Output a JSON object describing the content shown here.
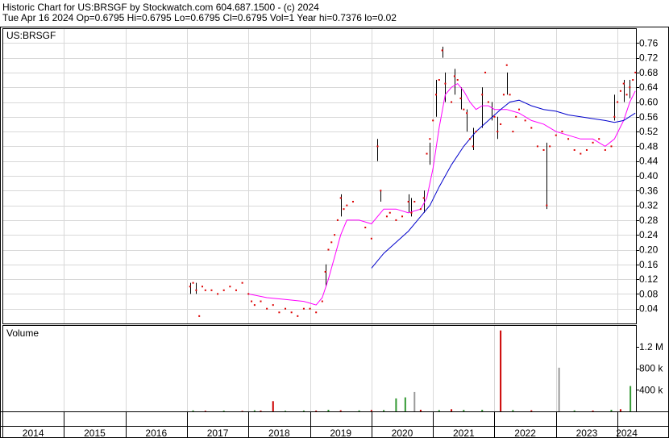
{
  "header": {
    "line1": "Historic Chart for US:BRSGF by Stockwatch.com 604.687.1500 - (c) 2024",
    "line2": "Tue Apr 16 2024   Op=0.6795   Hi=0.6795   Lo=0.6795   Cl=0.6795   Vol=1   Year hi=0.7376   lo=0.02"
  },
  "chart_data": [
    {
      "type": "line",
      "title": "US:BRSGF",
      "ylim": [
        0,
        0.8
      ],
      "y_ticks": [
        "0.04",
        "0.08",
        "0.12",
        "0.16",
        "0.20",
        "0.24",
        "0.28",
        "0.32",
        "0.36",
        "0.40",
        "0.44",
        "0.48",
        "0.52",
        "0.56",
        "0.60",
        "0.64",
        "0.68",
        "0.72",
        "0.76"
      ],
      "grid": true,
      "x_labels": [
        "2014",
        "2015",
        "2016",
        "2017",
        "2018",
        "2019",
        "2020",
        "2021",
        "2022",
        "2023",
        "2024"
      ],
      "x_range": [
        2014.0,
        2024.3
      ],
      "price_color": "#dd0000",
      "bar_color": "#000000",
      "series": [
        {
          "kind": "price",
          "points": [
            [
              2017.05,
              0.1
            ],
            [
              2017.1,
              0.11
            ],
            [
              2017.15,
              0.09
            ],
            [
              2017.2,
              0.02
            ],
            [
              2017.25,
              0.1
            ],
            [
              2017.3,
              0.09
            ],
            [
              2017.4,
              0.09
            ],
            [
              2017.5,
              0.08
            ],
            [
              2017.6,
              0.09
            ],
            [
              2017.7,
              0.1
            ],
            [
              2017.8,
              0.09
            ],
            [
              2017.9,
              0.11
            ],
            [
              2018.0,
              0.08
            ],
            [
              2018.05,
              0.06
            ],
            [
              2018.1,
              0.05
            ],
            [
              2018.2,
              0.06
            ],
            [
              2018.3,
              0.04
            ],
            [
              2018.4,
              0.05
            ],
            [
              2018.5,
              0.03
            ],
            [
              2018.6,
              0.04
            ],
            [
              2018.7,
              0.03
            ],
            [
              2018.8,
              0.02
            ],
            [
              2018.9,
              0.04
            ],
            [
              2019.0,
              0.04
            ],
            [
              2019.1,
              0.03
            ],
            [
              2019.2,
              0.06
            ],
            [
              2019.25,
              0.14
            ],
            [
              2019.3,
              0.2
            ],
            [
              2019.35,
              0.22
            ],
            [
              2019.4,
              0.24
            ],
            [
              2019.45,
              0.28
            ],
            [
              2019.5,
              0.34
            ],
            [
              2019.55,
              0.31
            ],
            [
              2019.6,
              0.32
            ],
            [
              2019.7,
              0.33
            ],
            [
              2019.9,
              0.26
            ],
            [
              2020.0,
              0.23
            ],
            [
              2020.1,
              0.48
            ],
            [
              2020.15,
              0.36
            ],
            [
              2020.25,
              0.29
            ],
            [
              2020.3,
              0.3
            ],
            [
              2020.4,
              0.28
            ],
            [
              2020.5,
              0.29
            ],
            [
              2020.6,
              0.33
            ],
            [
              2020.65,
              0.3
            ],
            [
              2020.7,
              0.33
            ],
            [
              2020.8,
              0.31
            ],
            [
              2020.85,
              0.34
            ],
            [
              2020.9,
              0.46
            ],
            [
              2020.95,
              0.5
            ],
            [
              2021.0,
              0.55
            ],
            [
              2021.05,
              0.62
            ],
            [
              2021.1,
              0.66
            ],
            [
              2021.15,
              0.74
            ],
            [
              2021.2,
              0.65
            ],
            [
              2021.3,
              0.6
            ],
            [
              2021.35,
              0.67
            ],
            [
              2021.4,
              0.66
            ],
            [
              2021.45,
              0.61
            ],
            [
              2021.5,
              0.58
            ],
            [
              2021.55,
              0.57
            ],
            [
              2021.6,
              0.5
            ],
            [
              2021.65,
              0.48
            ],
            [
              2021.7,
              0.52
            ],
            [
              2021.8,
              0.62
            ],
            [
              2021.85,
              0.68
            ],
            [
              2021.9,
              0.6
            ],
            [
              2022.0,
              0.56
            ],
            [
              2022.05,
              0.52
            ],
            [
              2022.1,
              0.54
            ],
            [
              2022.15,
              0.62
            ],
            [
              2022.2,
              0.7
            ],
            [
              2022.25,
              0.62
            ],
            [
              2022.3,
              0.52
            ],
            [
              2022.35,
              0.56
            ],
            [
              2022.4,
              0.58
            ],
            [
              2022.5,
              0.55
            ],
            [
              2022.6,
              0.53
            ],
            [
              2022.7,
              0.48
            ],
            [
              2022.8,
              0.47
            ],
            [
              2022.85,
              0.32
            ],
            [
              2022.9,
              0.48
            ],
            [
              2023.0,
              0.51
            ],
            [
              2023.1,
              0.52
            ],
            [
              2023.2,
              0.5
            ],
            [
              2023.3,
              0.47
            ],
            [
              2023.4,
              0.46
            ],
            [
              2023.5,
              0.47
            ],
            [
              2023.6,
              0.49
            ],
            [
              2023.7,
              0.5
            ],
            [
              2023.8,
              0.47
            ],
            [
              2023.9,
              0.48
            ],
            [
              2023.95,
              0.56
            ],
            [
              2024.0,
              0.6
            ],
            [
              2024.05,
              0.63
            ],
            [
              2024.1,
              0.65
            ],
            [
              2024.15,
              0.62
            ],
            [
              2024.2,
              0.64
            ],
            [
              2024.25,
              0.66
            ],
            [
              2024.29,
              0.68
            ]
          ]
        },
        {
          "kind": "hl_bar",
          "bars": [
            [
              2017.05,
              0.08,
              0.11
            ],
            [
              2017.15,
              0.08,
              0.11
            ],
            [
              2019.25,
              0.1,
              0.16
            ],
            [
              2019.5,
              0.29,
              0.35
            ],
            [
              2020.1,
              0.44,
              0.5
            ],
            [
              2020.15,
              0.33,
              0.36
            ],
            [
              2020.6,
              0.3,
              0.35
            ],
            [
              2020.65,
              0.29,
              0.34
            ],
            [
              2020.85,
              0.3,
              0.36
            ],
            [
              2020.95,
              0.43,
              0.49
            ],
            [
              2021.05,
              0.56,
              0.66
            ],
            [
              2021.15,
              0.72,
              0.75
            ],
            [
              2021.2,
              0.6,
              0.68
            ],
            [
              2021.35,
              0.62,
              0.69
            ],
            [
              2021.45,
              0.58,
              0.64
            ],
            [
              2021.55,
              0.52,
              0.58
            ],
            [
              2021.65,
              0.47,
              0.53
            ],
            [
              2021.8,
              0.53,
              0.64
            ],
            [
              2021.95,
              0.55,
              0.6
            ],
            [
              2022.05,
              0.5,
              0.56
            ],
            [
              2022.2,
              0.62,
              0.68
            ],
            [
              2022.85,
              0.31,
              0.49
            ],
            [
              2023.95,
              0.55,
              0.62
            ],
            [
              2024.1,
              0.6,
              0.66
            ],
            [
              2024.2,
              0.61,
              0.66
            ]
          ]
        },
        {
          "kind": "ma_short",
          "color": "#ff00ff",
          "points": [
            [
              2018.0,
              0.08
            ],
            [
              2018.3,
              0.07
            ],
            [
              2018.6,
              0.065
            ],
            [
              2018.9,
              0.06
            ],
            [
              2019.1,
              0.05
            ],
            [
              2019.2,
              0.07
            ],
            [
              2019.3,
              0.12
            ],
            [
              2019.4,
              0.18
            ],
            [
              2019.5,
              0.24
            ],
            [
              2019.6,
              0.28
            ],
            [
              2019.8,
              0.28
            ],
            [
              2020.0,
              0.27
            ],
            [
              2020.1,
              0.29
            ],
            [
              2020.2,
              0.31
            ],
            [
              2020.4,
              0.31
            ],
            [
              2020.6,
              0.3
            ],
            [
              2020.8,
              0.31
            ],
            [
              2020.9,
              0.34
            ],
            [
              2021.0,
              0.42
            ],
            [
              2021.1,
              0.53
            ],
            [
              2021.2,
              0.62
            ],
            [
              2021.3,
              0.64
            ],
            [
              2021.4,
              0.65
            ],
            [
              2021.5,
              0.63
            ],
            [
              2021.6,
              0.6
            ],
            [
              2021.7,
              0.58
            ],
            [
              2021.8,
              0.59
            ],
            [
              2021.9,
              0.59
            ],
            [
              2022.0,
              0.58
            ],
            [
              2022.2,
              0.58
            ],
            [
              2022.4,
              0.57
            ],
            [
              2022.6,
              0.55
            ],
            [
              2022.8,
              0.54
            ],
            [
              2023.0,
              0.52
            ],
            [
              2023.2,
              0.51
            ],
            [
              2023.4,
              0.5
            ],
            [
              2023.6,
              0.5
            ],
            [
              2023.8,
              0.48
            ],
            [
              2023.95,
              0.5
            ],
            [
              2024.1,
              0.55
            ],
            [
              2024.2,
              0.6
            ],
            [
              2024.29,
              0.63
            ]
          ]
        },
        {
          "kind": "ma_long",
          "color": "#0000cc",
          "points": [
            [
              2020.0,
              0.15
            ],
            [
              2020.2,
              0.19
            ],
            [
              2020.4,
              0.22
            ],
            [
              2020.6,
              0.25
            ],
            [
              2020.8,
              0.29
            ],
            [
              2020.95,
              0.32
            ],
            [
              2021.1,
              0.37
            ],
            [
              2021.3,
              0.43
            ],
            [
              2021.5,
              0.48
            ],
            [
              2021.7,
              0.52
            ],
            [
              2021.9,
              0.55
            ],
            [
              2022.1,
              0.58
            ],
            [
              2022.25,
              0.6
            ],
            [
              2022.4,
              0.605
            ],
            [
              2022.6,
              0.59
            ],
            [
              2022.8,
              0.58
            ],
            [
              2023.0,
              0.575
            ],
            [
              2023.2,
              0.565
            ],
            [
              2023.4,
              0.56
            ],
            [
              2023.6,
              0.555
            ],
            [
              2023.8,
              0.55
            ],
            [
              2023.95,
              0.545
            ],
            [
              2024.1,
              0.55
            ],
            [
              2024.29,
              0.57
            ]
          ]
        }
      ]
    },
    {
      "type": "bar",
      "title": "Volume",
      "ylim": [
        0,
        1600000
      ],
      "y_ticks": [
        "400 k",
        "800 k",
        "1.2 M"
      ],
      "y_tick_values": [
        400000,
        800000,
        1200000
      ],
      "bars": [
        [
          2017.1,
          18000,
          "#339933"
        ],
        [
          2017.3,
          12000,
          "#cc0000"
        ],
        [
          2017.6,
          14000,
          "#339933"
        ],
        [
          2017.9,
          10000,
          "#cc0000"
        ],
        [
          2018.1,
          20000,
          "#339933"
        ],
        [
          2018.2,
          15000,
          "#cc0000"
        ],
        [
          2018.4,
          190000,
          "#cc0000"
        ],
        [
          2018.6,
          12000,
          "#339933"
        ],
        [
          2018.9,
          16000,
          "#339933"
        ],
        [
          2019.1,
          15000,
          "#cc0000"
        ],
        [
          2019.3,
          30000,
          "#339933"
        ],
        [
          2019.5,
          20000,
          "#cc0000"
        ],
        [
          2019.8,
          18000,
          "#339933"
        ],
        [
          2020.0,
          25000,
          "#cc0000"
        ],
        [
          2020.2,
          25000,
          "#339933"
        ],
        [
          2020.4,
          240000,
          "#339933"
        ],
        [
          2020.55,
          260000,
          "#339933"
        ],
        [
          2020.7,
          360000,
          "#999999"
        ],
        [
          2020.8,
          30000,
          "#cc0000"
        ],
        [
          2021.1,
          25000,
          "#339933"
        ],
        [
          2021.3,
          40000,
          "#cc0000"
        ],
        [
          2021.5,
          28000,
          "#339933"
        ],
        [
          2021.8,
          30000,
          "#339933"
        ],
        [
          2022.1,
          1500000,
          "#cc0000"
        ],
        [
          2022.3,
          25000,
          "#339933"
        ],
        [
          2022.6,
          20000,
          "#cc0000"
        ],
        [
          2023.05,
          810000,
          "#999999"
        ],
        [
          2023.3,
          18000,
          "#339933"
        ],
        [
          2023.6,
          15000,
          "#cc0000"
        ],
        [
          2023.9,
          30000,
          "#339933"
        ],
        [
          2024.05,
          40000,
          "#cc0000"
        ],
        [
          2024.21,
          470000,
          "#339933"
        ]
      ]
    }
  ]
}
